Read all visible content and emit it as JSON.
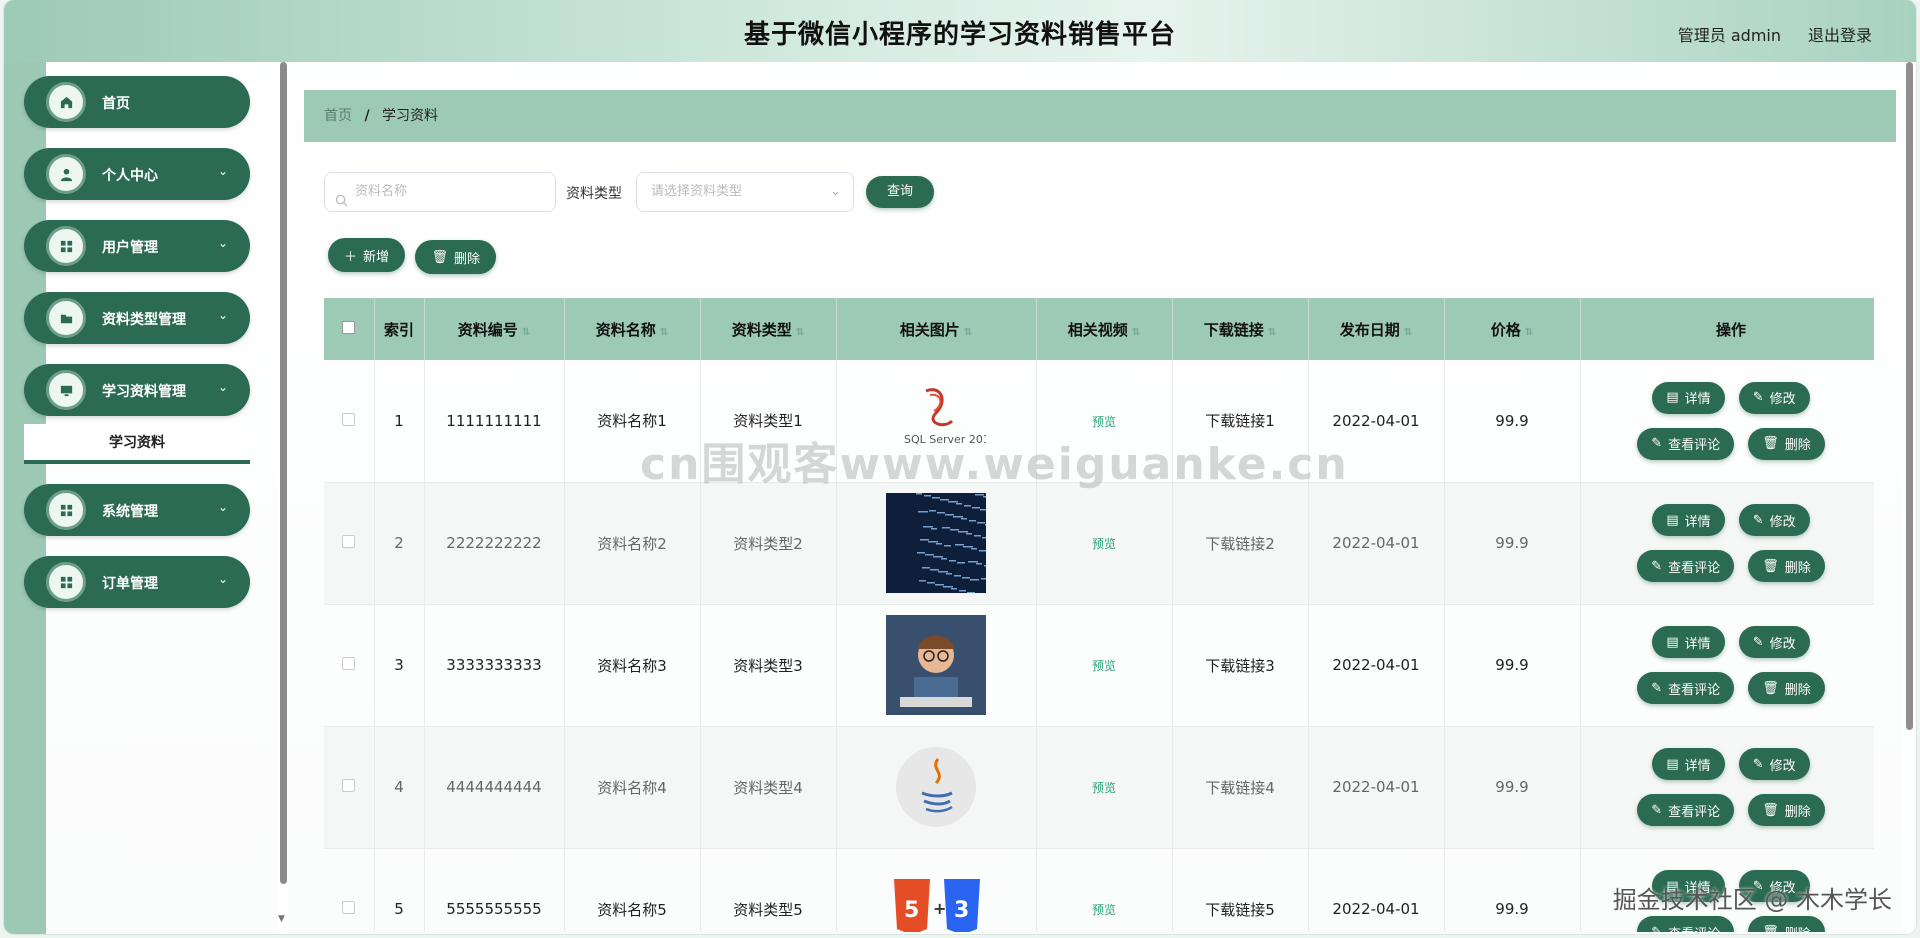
{
  "header": {
    "title": "基于微信小程序的学习资料销售平台",
    "user": "管理员 admin",
    "logout": "退出登录"
  },
  "sidebar": {
    "items": [
      {
        "label": "首页",
        "icon": "home-icon",
        "has_chevron": false
      },
      {
        "label": "个人中心",
        "icon": "user-icon",
        "has_chevron": true
      },
      {
        "label": "用户管理",
        "icon": "grid-icon",
        "has_chevron": true
      },
      {
        "label": "资料类型管理",
        "icon": "folder-icon",
        "has_chevron": true
      },
      {
        "label": "学习资料管理",
        "icon": "monitor-icon",
        "has_chevron": true
      },
      {
        "label": "系统管理",
        "icon": "grid-icon",
        "has_chevron": true
      },
      {
        "label": "订单管理",
        "icon": "grid-icon",
        "has_chevron": true
      }
    ],
    "subitem": "学习资料"
  },
  "breadcrumb": {
    "home": "首页",
    "separator": "/",
    "current": "学习资料"
  },
  "search": {
    "name_placeholder": "资料名称",
    "type_label": "资料类型",
    "type_placeholder": "请选择资料类型",
    "query_button": "查询"
  },
  "actions": {
    "add": "新增",
    "delete": "删除"
  },
  "table": {
    "headers": [
      "",
      "索引",
      "资料编号",
      "资料名称",
      "资料类型",
      "相关图片",
      "相关视频",
      "下载链接",
      "发布日期",
      "价格",
      "操作"
    ],
    "rows": [
      {
        "index": "1",
        "code": "1111111111",
        "name": "资料名称1",
        "type": "资料类型1",
        "image": "sql-server-logo",
        "video": "预览",
        "link": "下载链接1",
        "date": "2022-04-01",
        "price": "99.9"
      },
      {
        "index": "2",
        "code": "2222222222",
        "name": "资料名称2",
        "type": "资料类型2",
        "image": "code-stream-image",
        "video": "预览",
        "link": "下载链接2",
        "date": "2022-04-01",
        "price": "99.9"
      },
      {
        "index": "3",
        "code": "3333333333",
        "name": "资料名称3",
        "type": "资料类型3",
        "image": "kid-at-keyboard-image",
        "video": "预览",
        "link": "下载链接3",
        "date": "2022-04-01",
        "price": "99.9"
      },
      {
        "index": "4",
        "code": "4444444444",
        "name": "资料名称4",
        "type": "资料类型4",
        "image": "java-logo",
        "video": "预览",
        "link": "下载链接4",
        "date": "2022-04-01",
        "price": "99.9"
      },
      {
        "index": "5",
        "code": "5555555555",
        "name": "资料名称5",
        "type": "资料类型5",
        "image": "html5-css3-logo",
        "video": "预览",
        "link": "下载链接5",
        "date": "2022-04-01",
        "price": "99.9"
      }
    ],
    "row_ops": {
      "detail": "详情",
      "edit": "修改",
      "comments": "查看评论",
      "delete": "删除"
    }
  },
  "watermark": "cn围观客www.weiguanke.cn",
  "corner_mark": "掘金技术社区 @ 木木学长",
  "colors": {
    "primary": "#2b6a53",
    "header_bg": "#9dcab5",
    "accent_link": "#2aa37a"
  }
}
